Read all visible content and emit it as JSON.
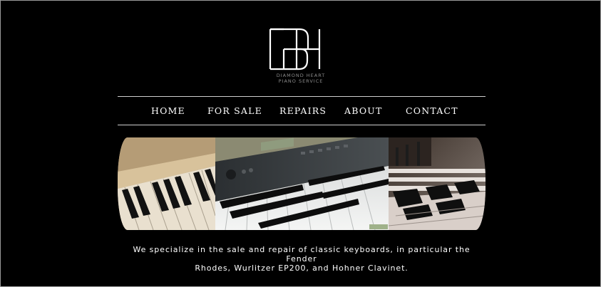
{
  "brand": {
    "logo_mark": "DH",
    "name_line1": "DIAMOND HEART",
    "name_line2": "PIANO SERVICE"
  },
  "nav": {
    "items": [
      {
        "label": "HOME"
      },
      {
        "label": "FOR SALE"
      },
      {
        "label": "REPAIRS"
      },
      {
        "label": "ABOUT"
      },
      {
        "label": "CONTACT"
      }
    ]
  },
  "banner": {
    "images": [
      {
        "icon": "upright-piano-keys-photo"
      },
      {
        "icon": "synthesizer-keyboard-photo"
      },
      {
        "icon": "piano-keys-closeup-photo"
      }
    ]
  },
  "tagline": {
    "line1": "We specialize in the sale and repair of classic keyboards, in particular the Fender",
    "line2": "Rhodes, Wurlitzer EP200, and Hohner Clavinet."
  },
  "colors": {
    "background": "#000000",
    "text": "#ffffff",
    "rule": "#cfcfcf",
    "logo_subtitle": "#8c8c8c"
  }
}
